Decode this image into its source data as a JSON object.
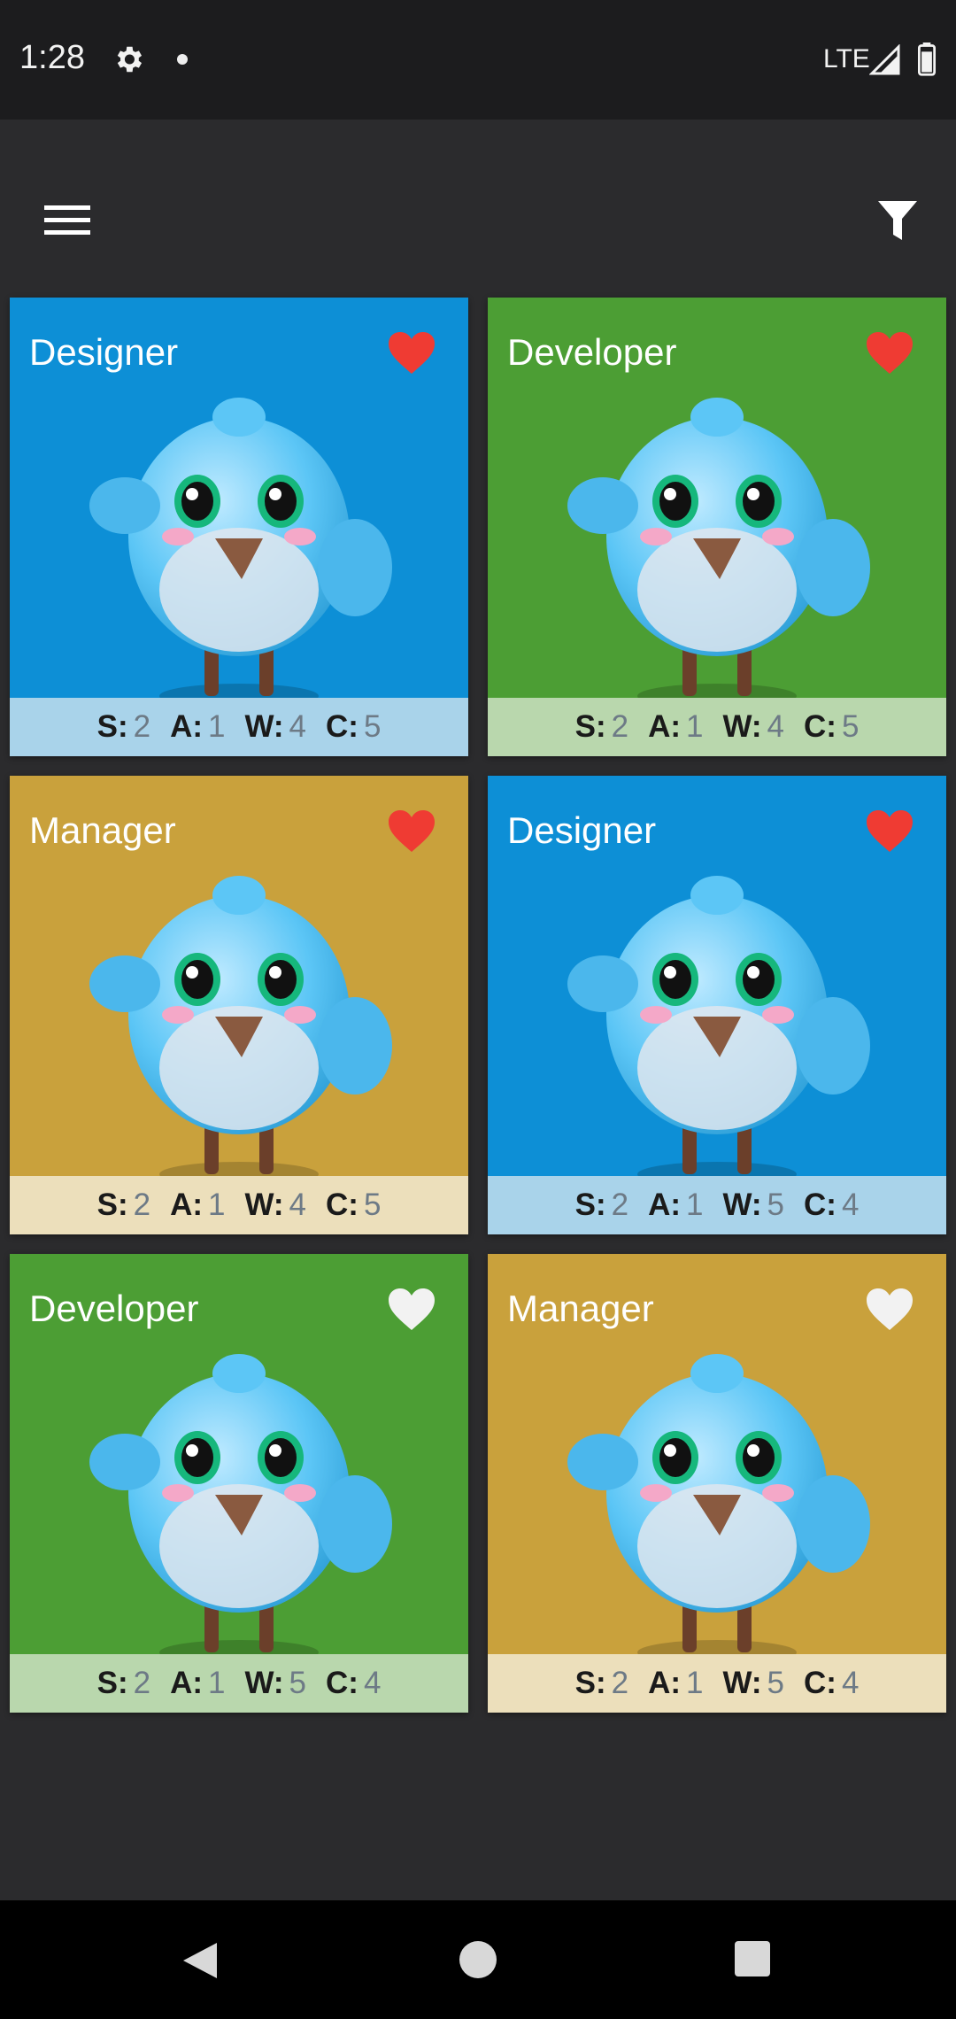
{
  "status_bar": {
    "time": "1:28",
    "network": "LTE",
    "icons": [
      "gear-icon",
      "dot-icon",
      "signal-icon",
      "battery-icon"
    ]
  },
  "app_bar": {
    "icons": [
      "menu-icon",
      "filter-icon"
    ]
  },
  "colors": {
    "blue": "#0d8fd6",
    "green": "#4c9e34",
    "gold": "#c9a13c",
    "heart_on": "#ef3b33",
    "heart_off": "#f2f2f2"
  },
  "cards": [
    {
      "title": "Designer",
      "bg": "#0d8fd6",
      "band": "#a9d3ea",
      "favorite": true,
      "stats": [
        {
          "k": "S:",
          "v": "2"
        },
        {
          "k": "A:",
          "v": "1"
        },
        {
          "k": "W:",
          "v": "4"
        },
        {
          "k": "C:",
          "v": "5"
        }
      ]
    },
    {
      "title": "Developer",
      "bg": "#4c9e34",
      "band": "#b9d7ad",
      "favorite": true,
      "stats": [
        {
          "k": "S:",
          "v": "2"
        },
        {
          "k": "A:",
          "v": "1"
        },
        {
          "k": "W:",
          "v": "4"
        },
        {
          "k": "C:",
          "v": "5"
        }
      ]
    },
    {
      "title": "Manager",
      "bg": "#c9a13c",
      "band": "#ecdfbb",
      "favorite": true,
      "stats": [
        {
          "k": "S:",
          "v": "2"
        },
        {
          "k": "A:",
          "v": "1"
        },
        {
          "k": "W:",
          "v": "4"
        },
        {
          "k": "C:",
          "v": "5"
        }
      ]
    },
    {
      "title": "Designer",
      "bg": "#0d8fd6",
      "band": "#a9d3ea",
      "favorite": true,
      "stats": [
        {
          "k": "S:",
          "v": "2"
        },
        {
          "k": "A:",
          "v": "1"
        },
        {
          "k": "W:",
          "v": "5"
        },
        {
          "k": "C:",
          "v": "4"
        }
      ]
    },
    {
      "title": "Developer",
      "bg": "#4c9e34",
      "band": "#b9d7ad",
      "favorite": false,
      "stats": [
        {
          "k": "S:",
          "v": "2"
        },
        {
          "k": "A:",
          "v": "1"
        },
        {
          "k": "W:",
          "v": "5"
        },
        {
          "k": "C:",
          "v": "4"
        }
      ]
    },
    {
      "title": "Manager",
      "bg": "#c9a13c",
      "band": "#ecdfbb",
      "favorite": false,
      "stats": [
        {
          "k": "S:",
          "v": "2"
        },
        {
          "k": "A:",
          "v": "1"
        },
        {
          "k": "W:",
          "v": "5"
        },
        {
          "k": "C:",
          "v": "4"
        }
      ]
    }
  ],
  "nav_bar": {
    "icons": [
      "back-icon",
      "home-icon",
      "recents-icon"
    ]
  }
}
